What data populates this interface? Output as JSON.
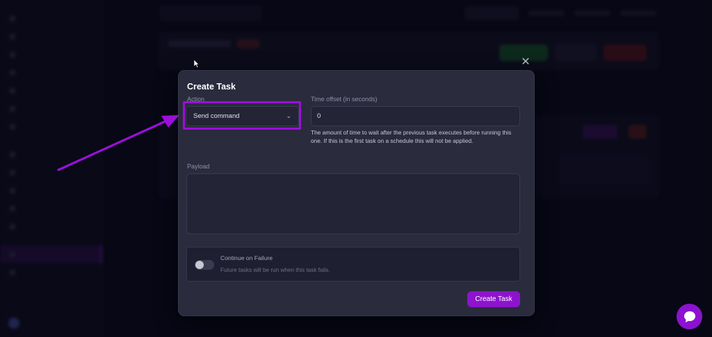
{
  "modal": {
    "title": "Create Task",
    "close_glyph": "✕",
    "action": {
      "label": "Action",
      "selected": "Send command",
      "chevron": "⌄"
    },
    "time_offset": {
      "label": "Time offset (in seconds)",
      "value": "0",
      "help": "The amount of time to wait after the previous task executes before running this one. If this is the first task on a schedule this will not be applied."
    },
    "payload": {
      "label": "Payload",
      "value": ""
    },
    "continue_on_failure": {
      "title": "Continue on Failure",
      "description": "Future tasks will be run when this task fails.",
      "enabled": false
    },
    "submit_label": "Create Task"
  },
  "colors": {
    "accent": "#8d14cc",
    "annotation": "#9a10d8",
    "modal_bg": "#2a2b3d",
    "page_bg": "#0a0a1a"
  },
  "icons": {
    "close": "close-icon",
    "chevron": "chevron-down-icon",
    "chat": "chat-bubble-icon",
    "cursor": "mouse-pointer-icon",
    "annotation_arrow": "arrow-icon"
  }
}
